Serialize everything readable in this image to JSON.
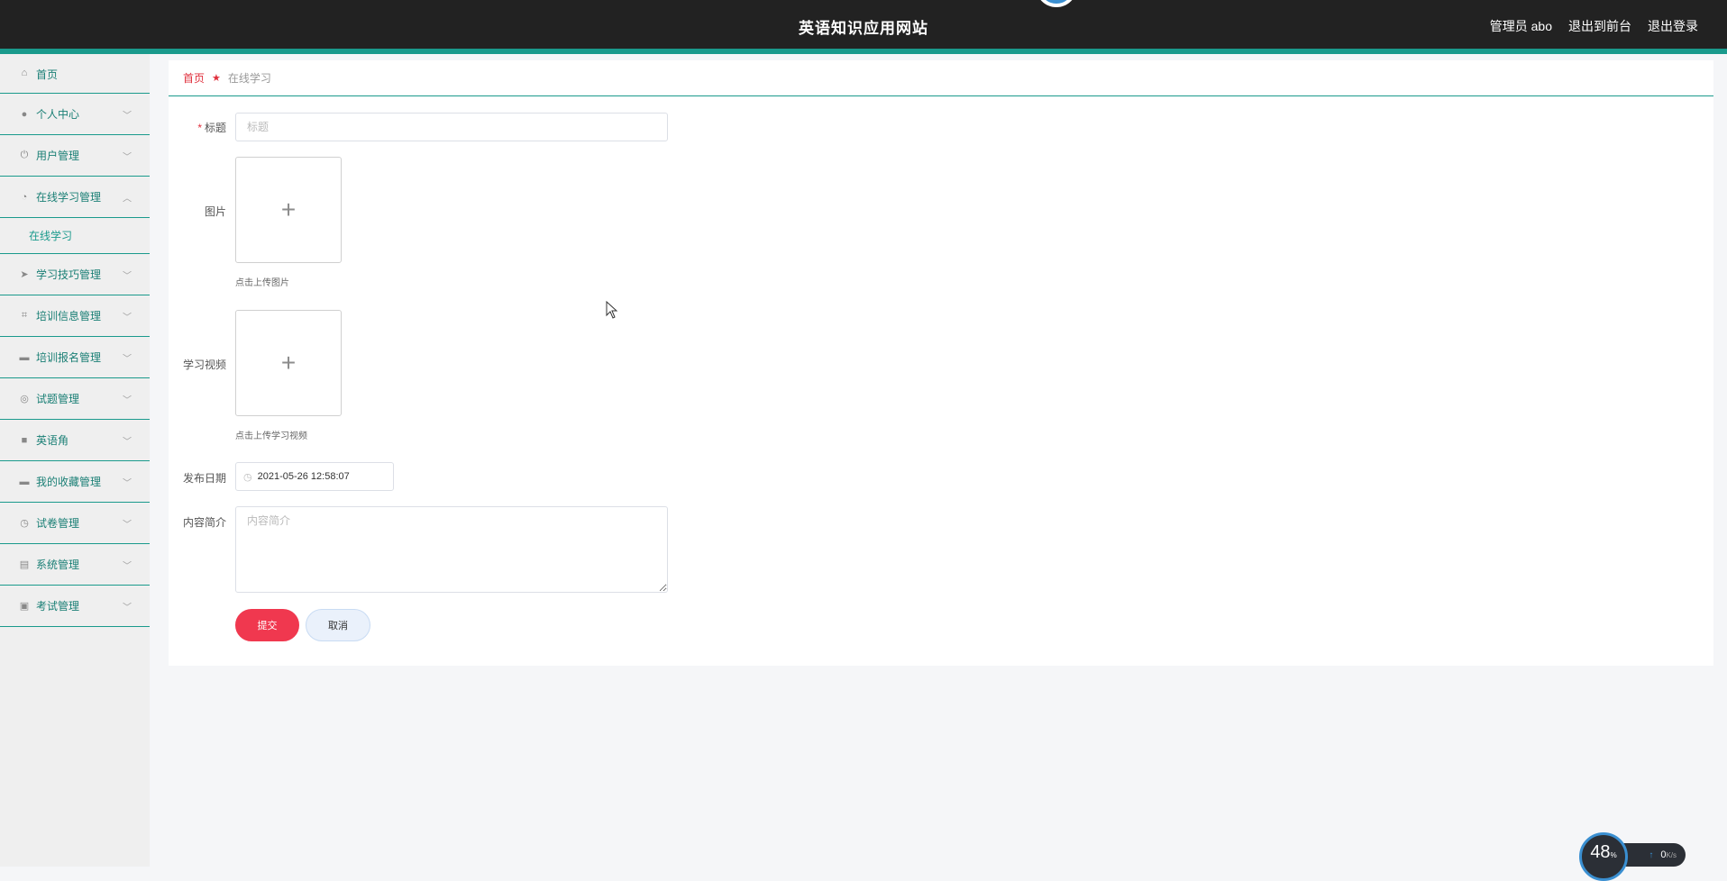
{
  "header": {
    "site_title": "英语知识应用网站",
    "admin_label": "管理员 abo",
    "front_link": "退出到前台",
    "logout_link": "退出登录"
  },
  "sidebar": {
    "items": [
      {
        "label": "首页",
        "icon": "home-icon"
      },
      {
        "label": "个人中心",
        "icon": "user-icon"
      },
      {
        "label": "用户管理",
        "icon": "power-icon"
      },
      {
        "label": "在线学习管理",
        "icon": "dashboard-icon",
        "expanded": true,
        "children": [
          {
            "label": "在线学习"
          }
        ]
      },
      {
        "label": "学习技巧管理",
        "icon": "send-icon"
      },
      {
        "label": "培训信息管理",
        "icon": "crop-icon"
      },
      {
        "label": "培训报名管理",
        "icon": "comment-icon"
      },
      {
        "label": "试题管理",
        "icon": "globe-icon"
      },
      {
        "label": "英语角",
        "icon": "briefcase-icon"
      },
      {
        "label": "我的收藏管理",
        "icon": "folder-icon"
      },
      {
        "label": "试卷管理",
        "icon": "clock-icon"
      },
      {
        "label": "系统管理",
        "icon": "clipboard-icon"
      },
      {
        "label": "考试管理",
        "icon": "check-clipboard-icon"
      }
    ]
  },
  "breadcrumb": {
    "home": "首页",
    "current": "在线学习"
  },
  "form": {
    "title_label": "标题",
    "title_placeholder": "标题",
    "image_label": "图片",
    "image_tip": "点击上传图片",
    "video_label": "学习视频",
    "video_tip": "点击上传学习视频",
    "date_label": "发布日期",
    "date_value": "2021-05-26 12:58:07",
    "intro_label": "内容简介",
    "intro_placeholder": "内容简介",
    "submit_label": "提交",
    "cancel_label": "取消"
  },
  "net_widget": {
    "percent": "48",
    "percent_unit": "%",
    "speed_value": "0",
    "speed_unit": "K/s"
  },
  "colors": {
    "accent": "#1a9a8c",
    "header_bg": "#222222",
    "submit_bg": "#f0384f",
    "breadcrumb_home": "#e0303d"
  }
}
